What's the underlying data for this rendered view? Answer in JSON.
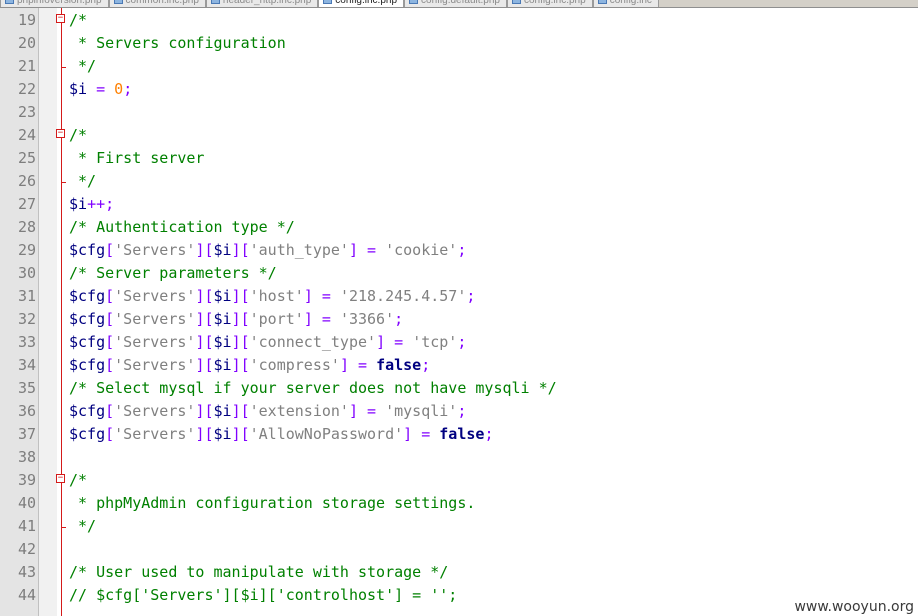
{
  "tabs": [
    {
      "label": "phpinfoversion.php",
      "active": false
    },
    {
      "label": "common.inc.php",
      "active": false
    },
    {
      "label": "header_http.inc.php",
      "active": false
    },
    {
      "label": "config.inc.php",
      "active": true
    },
    {
      "label": "config.default.php",
      "active": false
    },
    {
      "label": "config.inc.php",
      "active": false
    },
    {
      "label": "config.inc",
      "active": false
    }
  ],
  "editor": {
    "lines": [
      {
        "n": "19",
        "fold": "start",
        "tokens": [
          {
            "t": "/*",
            "c": "comment"
          }
        ]
      },
      {
        "n": "20",
        "tokens": [
          {
            "t": " * Servers configuration",
            "c": "comment"
          }
        ]
      },
      {
        "n": "21",
        "fold": "end",
        "tokens": [
          {
            "t": " */",
            "c": "comment"
          }
        ]
      },
      {
        "n": "22",
        "tokens": [
          {
            "t": "$i",
            "c": "var"
          },
          {
            "t": " = ",
            "c": "op"
          },
          {
            "t": "0",
            "c": "num"
          },
          {
            "t": ";",
            "c": "op"
          }
        ]
      },
      {
        "n": "23",
        "tokens": []
      },
      {
        "n": "24",
        "fold": "start",
        "tokens": [
          {
            "t": "/*",
            "c": "comment"
          }
        ]
      },
      {
        "n": "25",
        "tokens": [
          {
            "t": " * First server",
            "c": "comment"
          }
        ]
      },
      {
        "n": "26",
        "fold": "end",
        "tokens": [
          {
            "t": " */",
            "c": "comment"
          }
        ]
      },
      {
        "n": "27",
        "tokens": [
          {
            "t": "$i",
            "c": "var"
          },
          {
            "t": "++;",
            "c": "op"
          }
        ]
      },
      {
        "n": "28",
        "tokens": [
          {
            "t": "/* Authentication type */",
            "c": "comment"
          }
        ]
      },
      {
        "n": "29",
        "tokens": [
          {
            "t": "$cfg",
            "c": "var"
          },
          {
            "t": "[",
            "c": "op"
          },
          {
            "t": "'Servers'",
            "c": "str"
          },
          {
            "t": "][",
            "c": "op"
          },
          {
            "t": "$i",
            "c": "var"
          },
          {
            "t": "][",
            "c": "op"
          },
          {
            "t": "'auth_type'",
            "c": "str"
          },
          {
            "t": "] = ",
            "c": "op"
          },
          {
            "t": "'cookie'",
            "c": "str"
          },
          {
            "t": ";",
            "c": "op"
          }
        ]
      },
      {
        "n": "30",
        "tokens": [
          {
            "t": "/* Server parameters */",
            "c": "comment"
          }
        ]
      },
      {
        "n": "31",
        "tokens": [
          {
            "t": "$cfg",
            "c": "var"
          },
          {
            "t": "[",
            "c": "op"
          },
          {
            "t": "'Servers'",
            "c": "str"
          },
          {
            "t": "][",
            "c": "op"
          },
          {
            "t": "$i",
            "c": "var"
          },
          {
            "t": "][",
            "c": "op"
          },
          {
            "t": "'host'",
            "c": "str"
          },
          {
            "t": "] = ",
            "c": "op"
          },
          {
            "t": "'218.245.4.57'",
            "c": "str"
          },
          {
            "t": ";",
            "c": "op"
          }
        ]
      },
      {
        "n": "32",
        "tokens": [
          {
            "t": "$cfg",
            "c": "var"
          },
          {
            "t": "[",
            "c": "op"
          },
          {
            "t": "'Servers'",
            "c": "str"
          },
          {
            "t": "][",
            "c": "op"
          },
          {
            "t": "$i",
            "c": "var"
          },
          {
            "t": "][",
            "c": "op"
          },
          {
            "t": "'port'",
            "c": "str"
          },
          {
            "t": "] = ",
            "c": "op"
          },
          {
            "t": "'3366'",
            "c": "str"
          },
          {
            "t": ";",
            "c": "op"
          }
        ]
      },
      {
        "n": "33",
        "tokens": [
          {
            "t": "$cfg",
            "c": "var"
          },
          {
            "t": "[",
            "c": "op"
          },
          {
            "t": "'Servers'",
            "c": "str"
          },
          {
            "t": "][",
            "c": "op"
          },
          {
            "t": "$i",
            "c": "var"
          },
          {
            "t": "][",
            "c": "op"
          },
          {
            "t": "'connect_type'",
            "c": "str"
          },
          {
            "t": "] = ",
            "c": "op"
          },
          {
            "t": "'tcp'",
            "c": "str"
          },
          {
            "t": ";",
            "c": "op"
          }
        ]
      },
      {
        "n": "34",
        "tokens": [
          {
            "t": "$cfg",
            "c": "var"
          },
          {
            "t": "[",
            "c": "op"
          },
          {
            "t": "'Servers'",
            "c": "str"
          },
          {
            "t": "][",
            "c": "op"
          },
          {
            "t": "$i",
            "c": "var"
          },
          {
            "t": "][",
            "c": "op"
          },
          {
            "t": "'compress'",
            "c": "str"
          },
          {
            "t": "] = ",
            "c": "op"
          },
          {
            "t": "false",
            "c": "kw"
          },
          {
            "t": ";",
            "c": "op"
          }
        ]
      },
      {
        "n": "35",
        "tokens": [
          {
            "t": "/* Select mysql if your server does not have mysqli */",
            "c": "comment"
          }
        ]
      },
      {
        "n": "36",
        "tokens": [
          {
            "t": "$cfg",
            "c": "var"
          },
          {
            "t": "[",
            "c": "op"
          },
          {
            "t": "'Servers'",
            "c": "str"
          },
          {
            "t": "][",
            "c": "op"
          },
          {
            "t": "$i",
            "c": "var"
          },
          {
            "t": "][",
            "c": "op"
          },
          {
            "t": "'extension'",
            "c": "str"
          },
          {
            "t": "] = ",
            "c": "op"
          },
          {
            "t": "'mysqli'",
            "c": "str"
          },
          {
            "t": ";",
            "c": "op"
          }
        ]
      },
      {
        "n": "37",
        "tokens": [
          {
            "t": "$cfg",
            "c": "var"
          },
          {
            "t": "[",
            "c": "op"
          },
          {
            "t": "'Servers'",
            "c": "str"
          },
          {
            "t": "][",
            "c": "op"
          },
          {
            "t": "$i",
            "c": "var"
          },
          {
            "t": "][",
            "c": "op"
          },
          {
            "t": "'AllowNoPassword'",
            "c": "str"
          },
          {
            "t": "] = ",
            "c": "op"
          },
          {
            "t": "false",
            "c": "kw"
          },
          {
            "t": ";",
            "c": "op"
          }
        ]
      },
      {
        "n": "38",
        "tokens": []
      },
      {
        "n": "39",
        "fold": "start",
        "tokens": [
          {
            "t": "/*",
            "c": "comment"
          }
        ]
      },
      {
        "n": "40",
        "tokens": [
          {
            "t": " * phpMyAdmin configuration storage settings.",
            "c": "comment"
          }
        ]
      },
      {
        "n": "41",
        "fold": "end",
        "tokens": [
          {
            "t": " */",
            "c": "comment"
          }
        ]
      },
      {
        "n": "42",
        "tokens": []
      },
      {
        "n": "43",
        "tokens": [
          {
            "t": "/* User used to manipulate with storage */",
            "c": "comment"
          }
        ]
      },
      {
        "n": "44",
        "tokens": [
          {
            "t": "// $cfg['Servers'][$i]['controlhost'] = '';",
            "c": "comment"
          }
        ]
      }
    ]
  },
  "watermark": "www.wooyun.org"
}
